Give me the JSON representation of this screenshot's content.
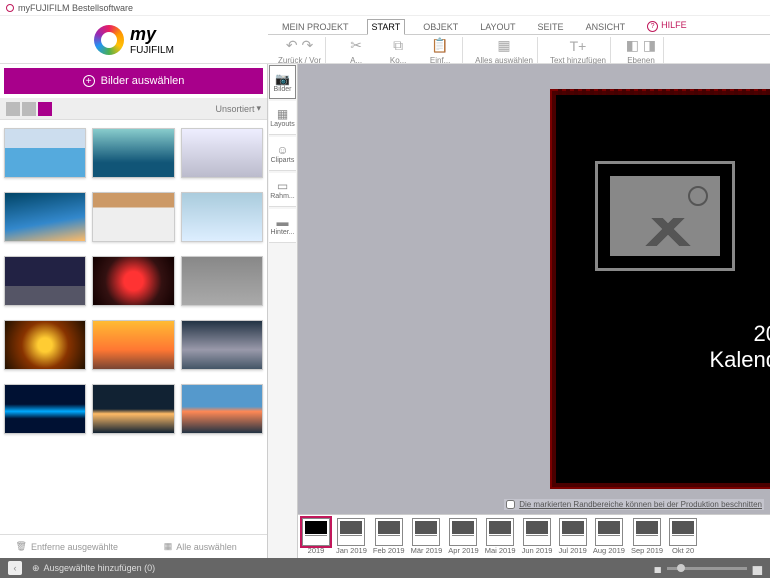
{
  "app": {
    "title": "myFUJIFILM Bestellsoftware",
    "brand_script": "my",
    "brand_name": "FUJIFILM"
  },
  "tabs": {
    "items": [
      "MEIN PROJEKT",
      "START",
      "OBJEKT",
      "LAYOUT",
      "SEITE",
      "ANSICHT"
    ],
    "active_index": 1,
    "help": "HILFE"
  },
  "toolbar": {
    "undo_redo": "Zurück / Vor",
    "cut": "A...",
    "copy": "Ko...",
    "paste": "Einf...",
    "select_all": "Alles auswählen",
    "add_text": "Text hinzufügen",
    "layers": "Ebenen"
  },
  "sidebar": {
    "select_images": "Bilder auswählen",
    "sort": "Unsortiert",
    "remove_selected": "Entferne ausgewählte",
    "select_all": "Alle auswählen"
  },
  "side_tools": {
    "images": "Bilder",
    "layouts": "Layouts",
    "cliparts": "Cliparts",
    "frames": "Rahm...",
    "backgrounds": "Hinter..."
  },
  "canvas": {
    "year": "20",
    "title": "Kalend",
    "crop_note": "Die markierten Randbereiche können bei der Produktion beschnitten"
  },
  "filmstrip": {
    "pages": [
      "2019",
      "Jan 2019",
      "Feb 2019",
      "Mär 2019",
      "Apr 2019",
      "Mai 2019",
      "Jun 2019",
      "Jul 2019",
      "Aug 2019",
      "Sep 2019",
      "Okt 20"
    ],
    "active_index": 0
  },
  "footer": {
    "add_selected": "Ausgewählte hinzufügen (0)"
  },
  "chart_data": null
}
